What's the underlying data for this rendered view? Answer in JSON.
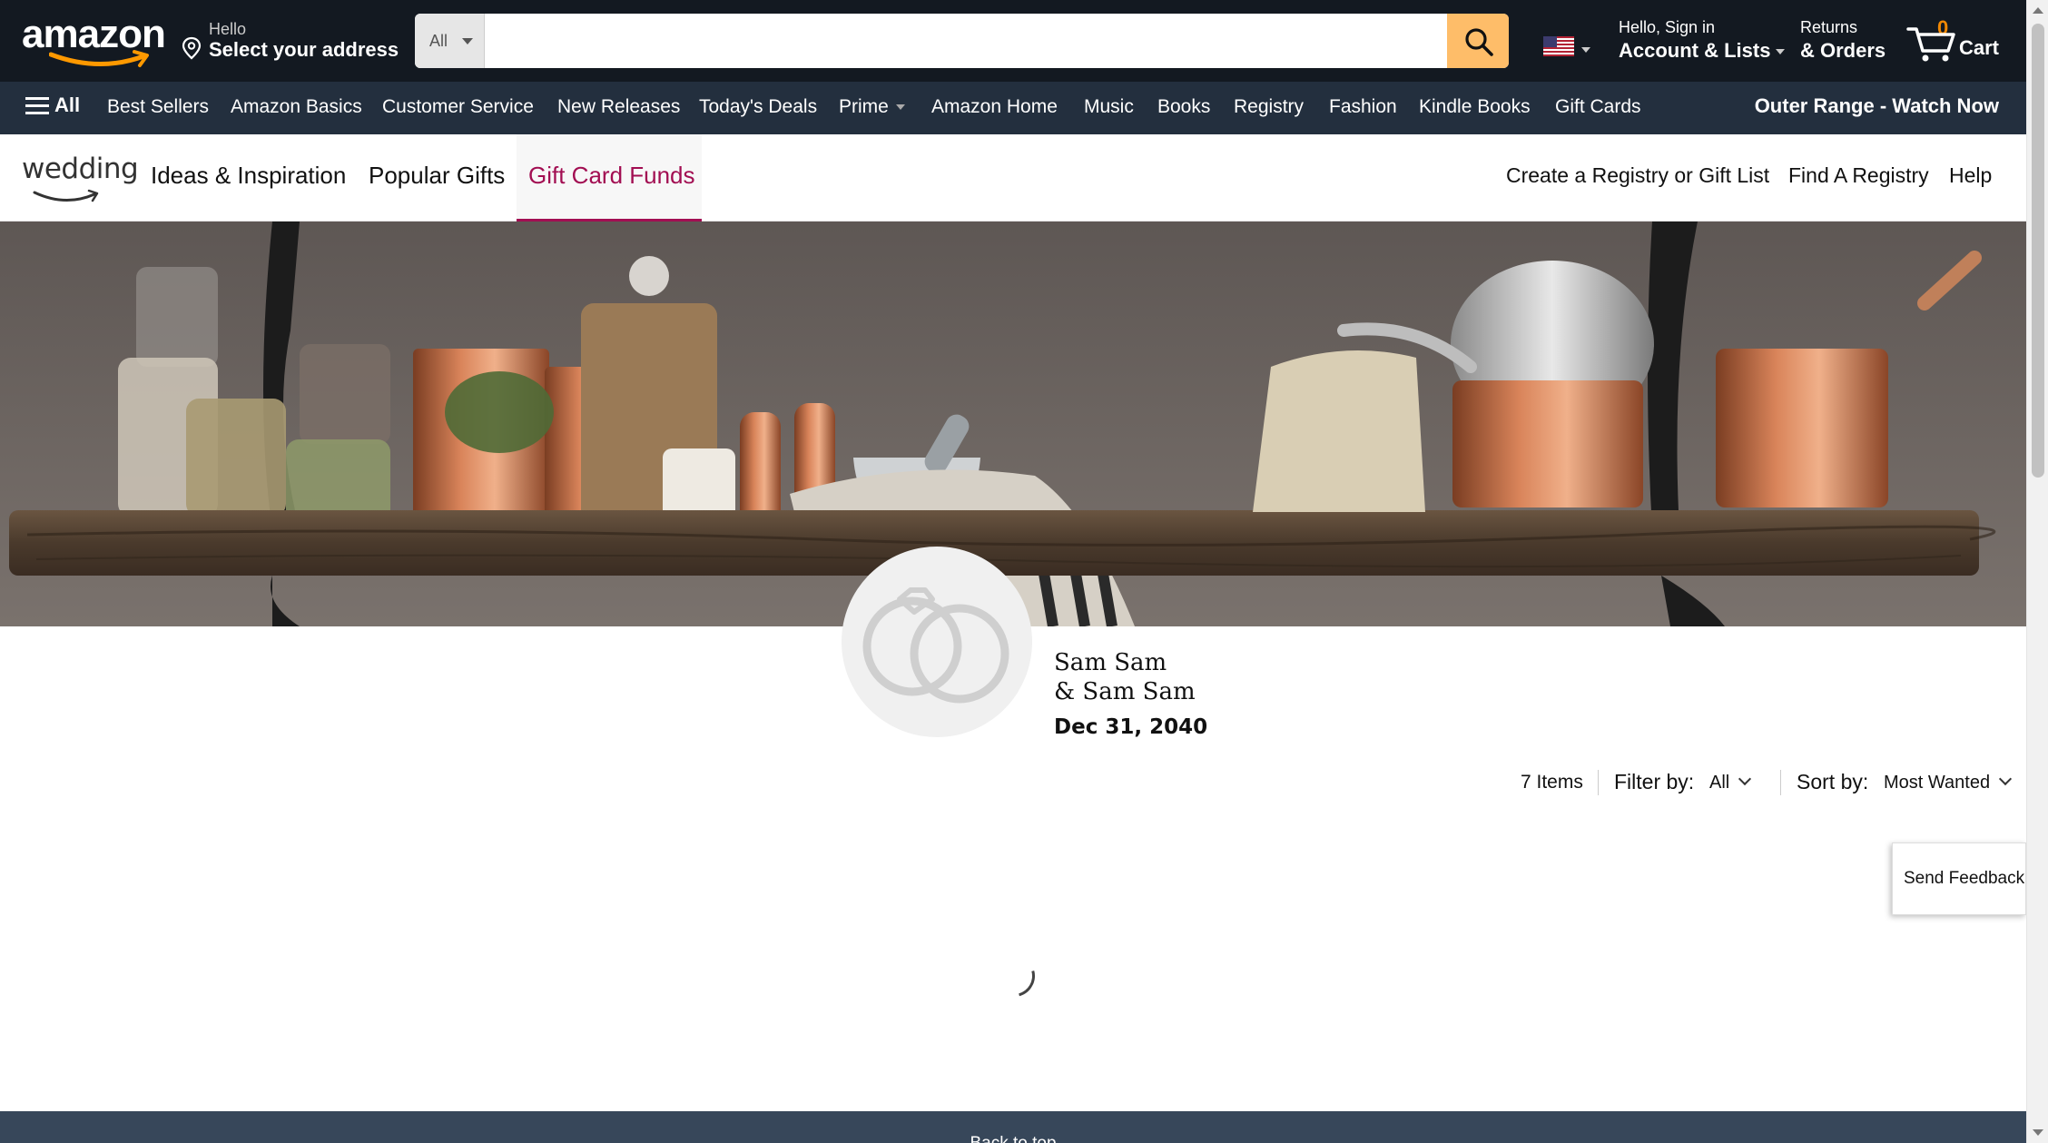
{
  "header": {
    "logo_text": "amazon",
    "deliver": {
      "line1": "Hello",
      "line2": "Select your address"
    },
    "search": {
      "category": "All",
      "placeholder": ""
    },
    "account": {
      "line1": "Hello, Sign in",
      "line2": "Account & Lists"
    },
    "returns": {
      "line1": "Returns",
      "line2": "& Orders"
    },
    "cart": {
      "count": "0",
      "label": "Cart"
    }
  },
  "nav": {
    "all_label": "All",
    "items": [
      "Best Sellers",
      "Amazon Basics",
      "Customer Service",
      "New Releases",
      "Today's Deals",
      "Prime",
      "Amazon Home",
      "Music",
      "Books",
      "Registry",
      "Fashion",
      "Kindle Books",
      "Gift Cards"
    ],
    "promo": "Outer Range - Watch Now"
  },
  "registry_nav": {
    "logo_text": "wedding",
    "tabs": [
      "Ideas & Inspiration",
      "Popular Gifts",
      "Gift Card Funds"
    ],
    "active_tab": "Gift Card Funds",
    "right_links": [
      "Create a Registry or Gift List",
      "Find A Registry",
      "Help"
    ]
  },
  "registry": {
    "name_line1": "Sam Sam",
    "name_line2": "& Sam Sam",
    "date": "Dec 31, 2040"
  },
  "toolbar": {
    "items_count": "7 Items",
    "filter_label": "Filter by:",
    "filter_value": "All",
    "sort_label": "Sort by:",
    "sort_value": "Most Wanted"
  },
  "feedback_label": "Send Feedback",
  "back_to_top": "Back to top",
  "colors": {
    "nav_dark": "#131921",
    "nav_secondary": "#232f3e",
    "search_button": "#febd69",
    "cart_count": "#f08804",
    "active_tab": "#a20e52"
  }
}
